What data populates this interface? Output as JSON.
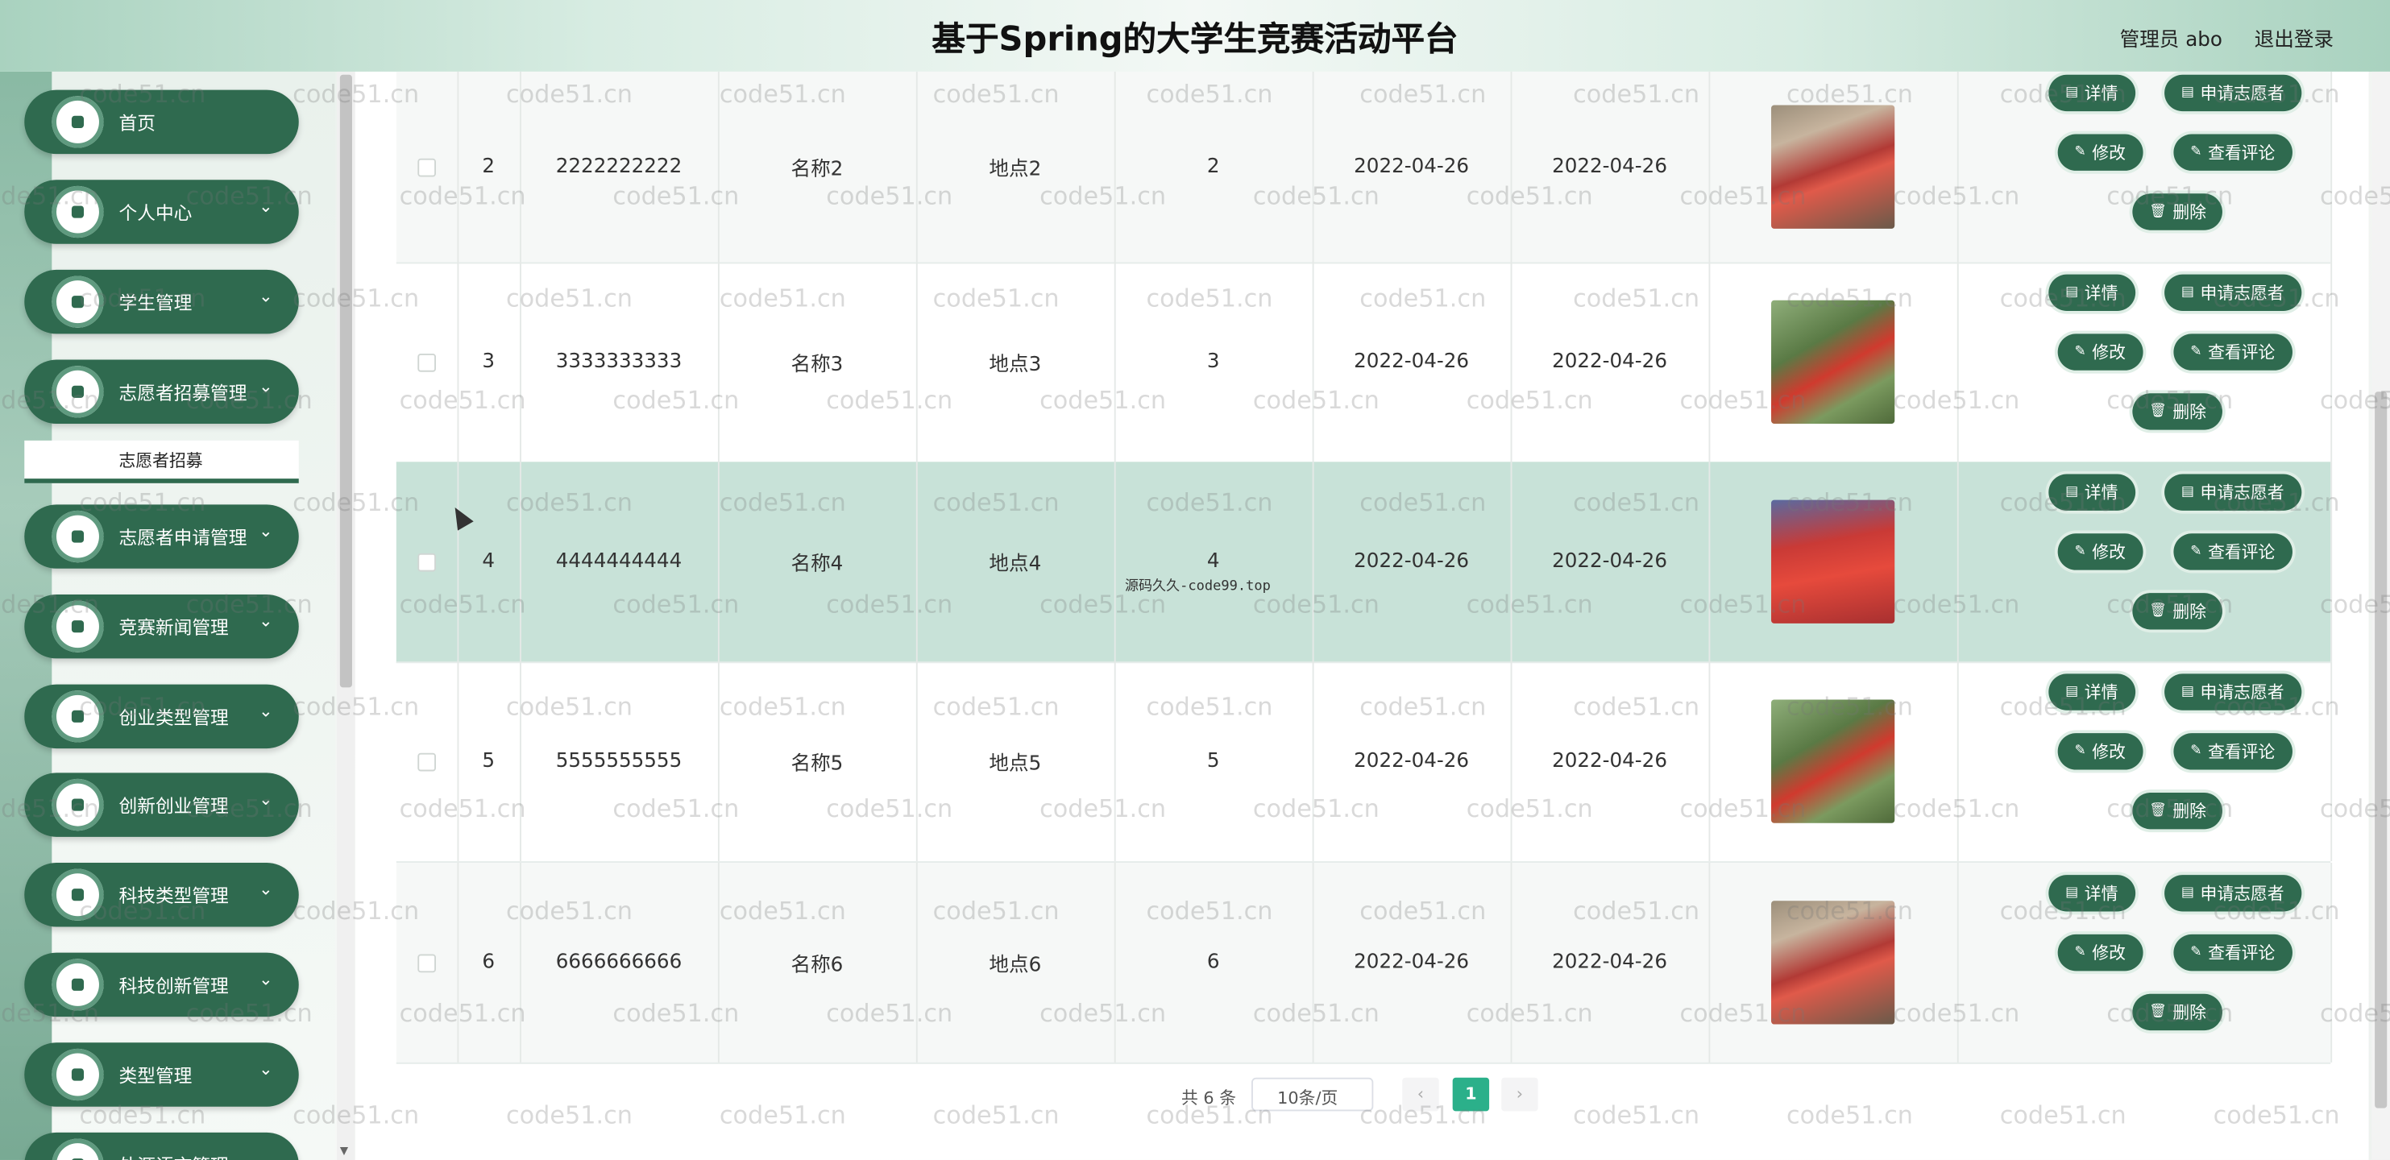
{
  "header": {
    "title": "基于Spring的大学生竞赛活动平台",
    "user": "管理员 abo",
    "logout": "退出登录"
  },
  "sidebar": {
    "items": [
      {
        "label": "首页",
        "chevron": ""
      },
      {
        "label": "个人中心",
        "chevron": "⌄"
      },
      {
        "label": "学生管理",
        "chevron": "⌄"
      },
      {
        "label": "志愿者招募管理",
        "chevron": "⌄"
      },
      {
        "label": "志愿者申请管理",
        "chevron": "⌄"
      },
      {
        "label": "竞赛新闻管理",
        "chevron": "⌄"
      },
      {
        "label": "创业类型管理",
        "chevron": "⌄"
      },
      {
        "label": "创新创业管理",
        "chevron": "⌄"
      },
      {
        "label": "科技类型管理",
        "chevron": "⌄"
      },
      {
        "label": "科技创新管理",
        "chevron": "⌄"
      },
      {
        "label": "类型管理",
        "chevron": "⌄"
      },
      {
        "label": "外源语言管理",
        "chevron": "⌄"
      }
    ],
    "submenu": "志愿者招募"
  },
  "table": {
    "rows": [
      {
        "index": "2",
        "code": "2222222222",
        "name": "名称2",
        "place": "地点2",
        "count": "2",
        "start": "2022-04-26",
        "end": "2022-04-26",
        "image": "photo-banner-group"
      },
      {
        "index": "3",
        "code": "3333333333",
        "name": "名称3",
        "place": "地点3",
        "count": "3",
        "start": "2022-04-26",
        "end": "2022-04-26",
        "image": "photo-flags-outdoor"
      },
      {
        "index": "4",
        "code": "4444444444",
        "name": "名称4",
        "place": "地点4",
        "count": "4",
        "start": "2022-04-26",
        "end": "2022-04-26",
        "image": "photo-crowd-red"
      },
      {
        "index": "5",
        "code": "5555555555",
        "name": "名称5",
        "place": "地点5",
        "count": "5",
        "start": "2022-04-26",
        "end": "2022-04-26",
        "image": "photo-flags-outdoor"
      },
      {
        "index": "6",
        "code": "6666666666",
        "name": "名称6",
        "place": "地点6",
        "count": "6",
        "start": "2022-04-26",
        "end": "2022-04-26",
        "image": "photo-banner-group"
      }
    ],
    "actions": {
      "detail": "详情",
      "apply": "申请志愿者",
      "edit": "修改",
      "comments": "查看评论",
      "delete": "删除"
    }
  },
  "overlay_text": "源码久久-code99.top",
  "pagination": {
    "total": "共 6 条",
    "page_size": "10条/页",
    "current_page": "1",
    "prev": "‹",
    "next": "›"
  },
  "watermark": "code51.cn",
  "colors": {
    "primary": "#2f6a4f",
    "highlight_row": "#c8e2d8",
    "page_active": "#2bb08a"
  }
}
